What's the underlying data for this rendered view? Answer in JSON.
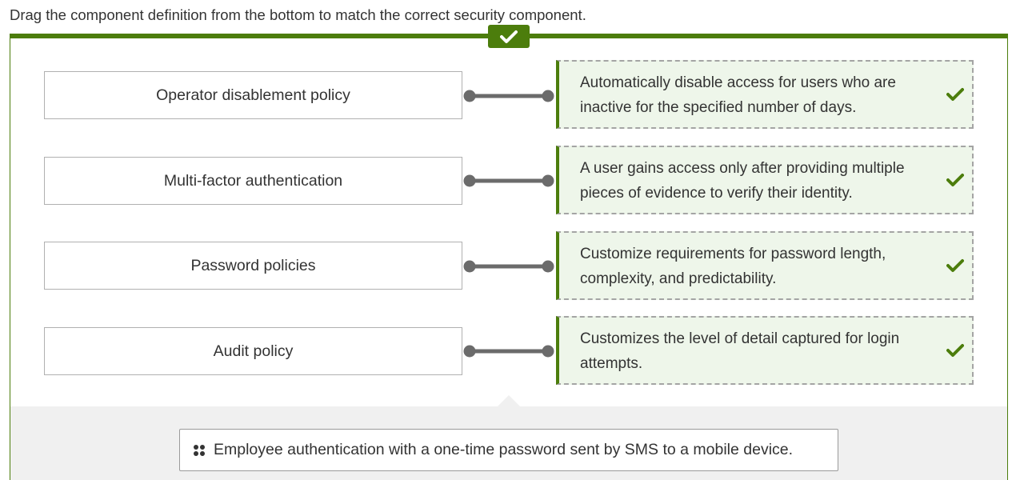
{
  "instructions": "Drag the component definition from the bottom to match the correct security component.",
  "status_icon": "checkmark-icon",
  "colors": {
    "accent_green": "#4c7d0c",
    "definition_bg": "#eef6ea",
    "pool_bg": "#f0f0f0",
    "connector": "#6b6b6b"
  },
  "pairs": [
    {
      "component": "Operator disablement policy",
      "definition": "Automatically disable access for users who are inactive for the specified number of days.",
      "correct": true
    },
    {
      "component": "Multi-factor authentication",
      "definition": "A user gains access only after providing multiple pieces of evidence to verify their identity.",
      "correct": true
    },
    {
      "component": "Password policies",
      "definition": "Customize requirements for password length, complexity, and predictability.",
      "correct": true
    },
    {
      "component": "Audit policy",
      "definition": "Customizes the level of detail captured for login attempts.",
      "correct": true
    }
  ],
  "pool": {
    "items": [
      {
        "label": "Employee authentication with a one-time password sent by SMS to a mobile device.",
        "icon": "drag-handle-icon"
      }
    ]
  }
}
